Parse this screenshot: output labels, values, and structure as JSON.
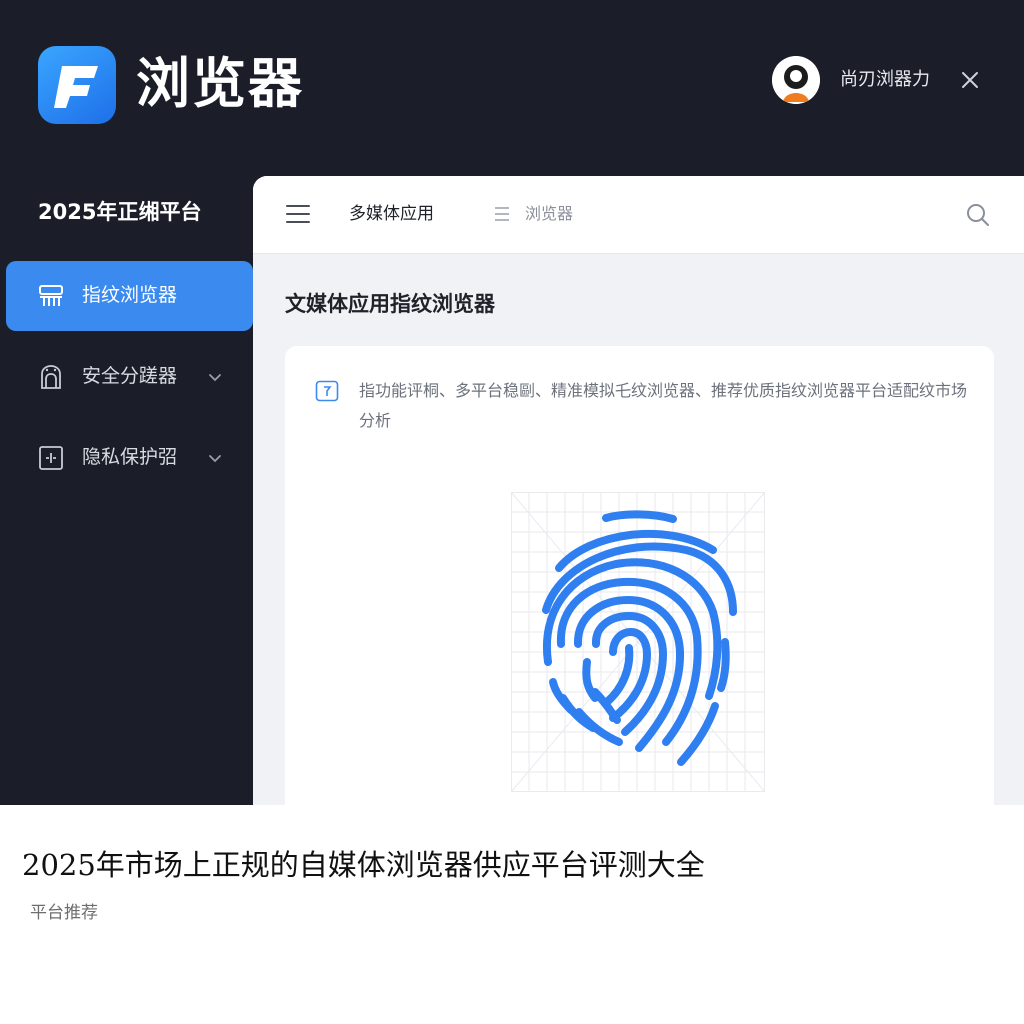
{
  "header": {
    "logo_letter": "F",
    "app_title": "浏览器",
    "user_name": "尚刃浏器力",
    "icons": [
      "app-logo-icon",
      "avatar-icon",
      "close-icon"
    ]
  },
  "sidebar": {
    "title": "2025年正缃平台",
    "items": [
      {
        "label": "指纹浏览器",
        "icon": "fingerprint-scanner-icon",
        "active": true
      },
      {
        "label": "安全分蹉器",
        "icon": "shield-lock-icon",
        "expandable": true
      },
      {
        "label": "隐私保护弨",
        "icon": "privacy-box-icon",
        "expandable": true
      }
    ]
  },
  "toolbar": {
    "tab_main": "多媒体应用",
    "tab_sub": "浏览器",
    "icons": [
      "menu-icon",
      "list-icon",
      "search-icon"
    ]
  },
  "main": {
    "heading": "文媒体应用指纹浏览器",
    "description": "指功能评桐、多平台稳剾、精准模拟乇纹浏览器、推荐优质指纹浏览器平台适配纹市场分析",
    "figure": "fingerprint-illustration"
  },
  "caption": {
    "title": "2025年市场上正规的自媒体浏览器供应平台评测大全",
    "subtitle": "平台推荐"
  },
  "colors": {
    "background_dark": "#1b1e29",
    "accent_blue": "#3b8af0",
    "fingerprint_blue": "#2f7ff0",
    "panel_light": "#f1f2f5"
  }
}
